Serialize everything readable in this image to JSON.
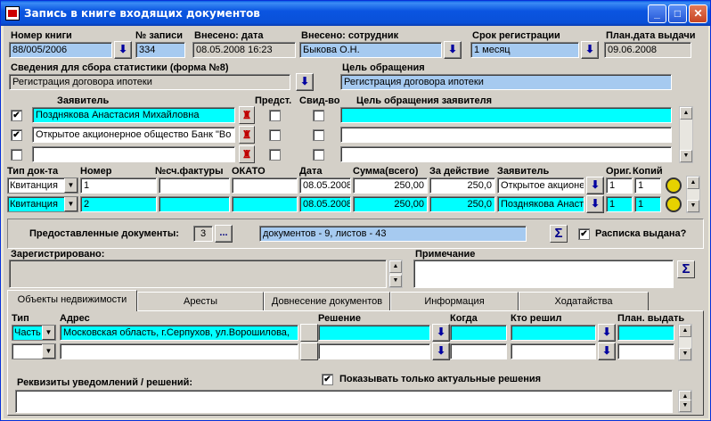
{
  "window": {
    "title": "Запись в книге входящих документов",
    "min": "_",
    "max": "□",
    "close": "✕"
  },
  "header": {
    "book_label": "Номер книги",
    "book_value": "88/005/2006",
    "record_label": "№ записи",
    "record_value": "334",
    "entered_date_label": "Внесено: дата",
    "entered_date_value": "08.05.2008 16:23",
    "entered_by_label": "Внесено: сотрудник",
    "entered_by_value": "Быкова О.Н.",
    "reg_term_label": "Срок регистрации",
    "reg_term_value": "1 месяц",
    "planned_label": "План.дата выдачи",
    "planned_value": "09.06.2008"
  },
  "stats": {
    "label": "Сведения для сбора статистики (форма №8)",
    "value": "Регистрация договора ипотеки"
  },
  "purpose": {
    "label": "Цель обращения",
    "value": "Регистрация договора ипотеки"
  },
  "applicants": {
    "col_applicant": "Заявитель",
    "col_repr": "Предст.",
    "col_cert": "Свид-во",
    "col_purpose": "Цель обращения заявителя",
    "rows": [
      {
        "checked": "✔",
        "name": "Позднякова Анастасия Михайловна"
      },
      {
        "checked": "✔",
        "name": "Открытое акционерное общество Банк \"Во"
      },
      {
        "checked": "",
        "name": ""
      }
    ]
  },
  "docs": {
    "col_type": "Тип док-та",
    "col_num": "Номер",
    "col_invoice": "№сч.фактуры",
    "col_okato": "ОКАТО",
    "col_date": "Дата",
    "col_sum": "Сумма(всего)",
    "col_action": "За действие",
    "col_applicant": "Заявитель",
    "col_orig": "Ориг.",
    "col_copies": "Копий",
    "rows": [
      {
        "type": "Квитанция",
        "num": "1",
        "date": "08.05.2008",
        "sum": "250,00",
        "action": "250,0",
        "applicant": "Открытое акционер",
        "orig": "1",
        "copies": "1"
      },
      {
        "type": "Квитанция",
        "num": "2",
        "date": "08.05.2008",
        "sum": "250,00",
        "action": "250,0",
        "applicant": "Позднякова Анаст",
        "orig": "1",
        "copies": "1"
      }
    ]
  },
  "provided": {
    "label": "Предоставленные документы:",
    "count": "3",
    "dots": "...",
    "summary": "документов - 9, листов - 43",
    "sigma": "Σ",
    "receipt_check": "✔",
    "receipt_label": "Расписка выдана?"
  },
  "registered": {
    "label": "Зарегистрировано:"
  },
  "note": {
    "label": "Примечание",
    "sigma": "Σ"
  },
  "tabs": [
    "Объекты недвижимости",
    "Аресты",
    "Довнесение документов",
    "Информация",
    "Ходатайства"
  ],
  "objects": {
    "col_type": "Тип",
    "col_address": "Адрес",
    "col_decision": "Решение",
    "col_when": "Когда",
    "col_who": "Кто решил",
    "col_planned": "План. выдать",
    "rows": [
      {
        "type": "Часть",
        "address": "Московская область, г.Серпухов, ул.Ворошилова,"
      }
    ]
  },
  "notify": {
    "label": "Реквизиты уведомлений / решений:",
    "actual_check": "✔",
    "actual_label": "Показывать только актуальные решения"
  },
  "colors": {
    "cyan": "#00ffff",
    "light_blue": "#a6caf0",
    "face": "#d4d0c8"
  }
}
